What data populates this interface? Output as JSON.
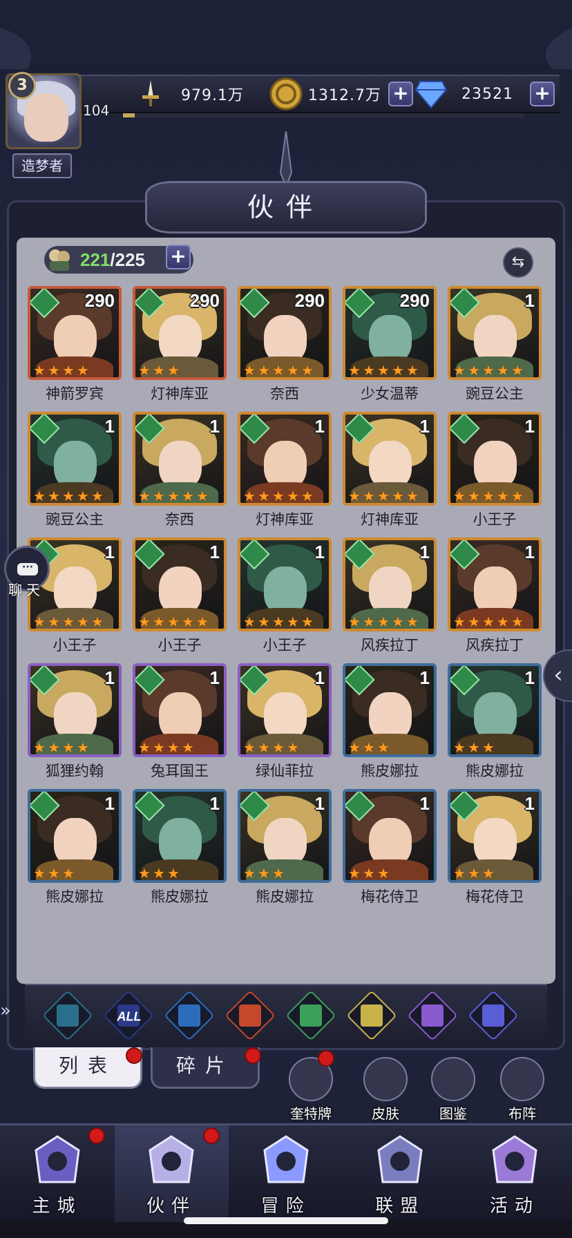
{
  "player": {
    "level": "3",
    "power": "104",
    "title": "造梦者"
  },
  "resources": {
    "power_value": "979.1万",
    "gold_value": "1312.7万",
    "gem_value": "23521",
    "plus": "+"
  },
  "panel": {
    "title": "伙伴",
    "count_current": "221",
    "count_total": "/225",
    "swap_icon": "⇆"
  },
  "heroes": [
    {
      "name": "神箭罗宾",
      "level": "290",
      "stars": 4,
      "frame": "red"
    },
    {
      "name": "灯神库亚",
      "level": "290",
      "stars": 3,
      "frame": "red"
    },
    {
      "name": "奈西",
      "level": "290",
      "stars": 5,
      "frame": "gold"
    },
    {
      "name": "少女温蒂",
      "level": "290",
      "stars": 5,
      "frame": "gold"
    },
    {
      "name": "豌豆公主",
      "level": "1",
      "stars": 5,
      "frame": "gold"
    },
    {
      "name": "豌豆公主",
      "level": "1",
      "stars": 5,
      "frame": "gold"
    },
    {
      "name": "奈西",
      "level": "1",
      "stars": 5,
      "frame": "gold"
    },
    {
      "name": "灯神库亚",
      "level": "1",
      "stars": 5,
      "frame": "gold"
    },
    {
      "name": "灯神库亚",
      "level": "1",
      "stars": 5,
      "frame": "gold"
    },
    {
      "name": "小王子",
      "level": "1",
      "stars": 5,
      "frame": "gold"
    },
    {
      "name": "小王子",
      "level": "1",
      "stars": 5,
      "frame": "gold"
    },
    {
      "name": "小王子",
      "level": "1",
      "stars": 5,
      "frame": "gold"
    },
    {
      "name": "小王子",
      "level": "1",
      "stars": 5,
      "frame": "gold"
    },
    {
      "name": "风疾拉丁",
      "level": "1",
      "stars": 5,
      "frame": "gold"
    },
    {
      "name": "风疾拉丁",
      "level": "1",
      "stars": 5,
      "frame": "gold"
    },
    {
      "name": "狐狸约翰",
      "level": "1",
      "stars": 4,
      "frame": "purple"
    },
    {
      "name": "兔耳国王",
      "level": "1",
      "stars": 4,
      "frame": "purple"
    },
    {
      "name": "绿仙菲拉",
      "level": "1",
      "stars": 4,
      "frame": "purple"
    },
    {
      "name": "熊皮娜拉",
      "level": "1",
      "stars": 3,
      "frame": "blue"
    },
    {
      "name": "熊皮娜拉",
      "level": "1",
      "stars": 3,
      "frame": "blue"
    },
    {
      "name": "熊皮娜拉",
      "level": "1",
      "stars": 3,
      "frame": "blue"
    },
    {
      "name": "熊皮娜拉",
      "level": "1",
      "stars": 3,
      "frame": "blue"
    },
    {
      "name": "熊皮娜拉",
      "level": "1",
      "stars": 3,
      "frame": "blue"
    },
    {
      "name": "梅花侍卫",
      "level": "1",
      "stars": 3,
      "frame": "blue"
    },
    {
      "name": "梅花侍卫",
      "level": "1",
      "stars": 3,
      "frame": "blue"
    }
  ],
  "chat": {
    "label": "聊天",
    "icon": "chat-bubble-icon"
  },
  "filters": [
    {
      "icon": "chevron-up-element-icon",
      "color": "#2a6f8a"
    },
    {
      "icon": "all-element-icon",
      "label": "ALL",
      "color": "#2a3a88"
    },
    {
      "icon": "water-element-icon",
      "color": "#2c6dbb"
    },
    {
      "icon": "fire-element-icon",
      "color": "#c4482c"
    },
    {
      "icon": "wind-element-icon",
      "color": "#3aa05a"
    },
    {
      "icon": "light-element-icon",
      "color": "#c8b24a"
    },
    {
      "icon": "moon-element-icon",
      "color": "#8a5ad0"
    },
    {
      "icon": "planet-element-icon",
      "color": "#5a5ed6"
    }
  ],
  "tabs": {
    "list": "列表",
    "fragments": "碎片"
  },
  "tools": [
    {
      "label": "奎特牌",
      "icon": "tarot-cards-icon"
    },
    {
      "label": "皮肤",
      "icon": "skin-outfit-icon"
    },
    {
      "label": "图鉴",
      "icon": "codex-book-icon"
    },
    {
      "label": "布阵",
      "icon": "formation-chess-icon"
    }
  ],
  "nav": [
    {
      "label": "主城",
      "icon": "castle-icon"
    },
    {
      "label": "伙伴",
      "icon": "wizard-hat-icon"
    },
    {
      "label": "冒险",
      "icon": "compass-star-icon"
    },
    {
      "label": "联盟",
      "icon": "shield-crest-icon"
    },
    {
      "label": "活动",
      "icon": "event-cards-icon"
    }
  ],
  "colors": {
    "accent_green": "#7ee06a",
    "notification_red": "#d21a1a",
    "star_orange": "#ff9b1f",
    "wind_element_green": "#2f8a4a"
  }
}
